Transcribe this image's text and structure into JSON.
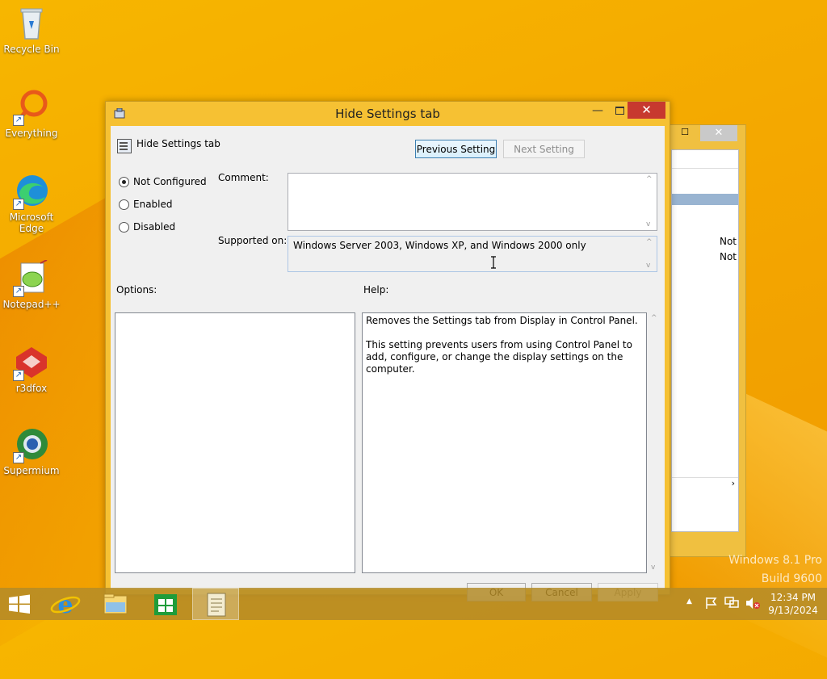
{
  "desktop": {
    "icons": [
      {
        "label": "Recycle Bin"
      },
      {
        "label": "Everything"
      },
      {
        "label": "Microsoft Edge"
      },
      {
        "label": "Notepad++"
      },
      {
        "label": "r3dfox"
      },
      {
        "label": "Supermium"
      }
    ],
    "watermark": {
      "line1": "Windows 8.1 Pro",
      "line2": "Build 9600"
    }
  },
  "background_window": {
    "close_glyph": "✕",
    "max_glyph": "☐",
    "values": [
      "Not",
      "Not"
    ],
    "scroll_right": "›"
  },
  "dialog": {
    "title": "Hide Settings tab",
    "minimize_glyph": "—",
    "close_glyph": "✕",
    "policy_name": "Hide Settings tab",
    "prev_button": "Previous Setting",
    "next_button": "Next Setting",
    "radios": [
      {
        "label": "Not Configured",
        "checked": true
      },
      {
        "label": "Enabled",
        "checked": false
      },
      {
        "label": "Disabled",
        "checked": false
      }
    ],
    "comment_label": "Comment:",
    "comment_value": "",
    "supported_label": "Supported on:",
    "supported_value": "Windows Server 2003, Windows XP, and Windows 2000 only",
    "options_label": "Options:",
    "help_label": "Help:",
    "help_text": "Removes the Settings tab from Display in Control Panel.\n\nThis setting prevents users from using Control Panel to add, configure, or change the display settings on the computer.",
    "ok_button": "OK",
    "cancel_button": "Cancel",
    "apply_button": "Apply",
    "scroll_up": "^",
    "scroll_down": "v"
  },
  "taskbar": {
    "time": "12:34 PM",
    "date": "9/13/2024",
    "tray_up": "▲"
  },
  "colors": {
    "wallpaper": "#f4a800",
    "close_red": "#c7392f",
    "dialog_frame": "#f6c133",
    "selection": "#99b4d1"
  }
}
